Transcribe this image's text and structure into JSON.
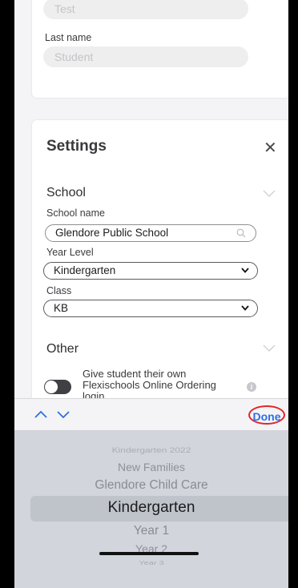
{
  "student": {
    "first_name_value": "Test",
    "last_name_label": "Last name",
    "last_name_placeholder": "Student"
  },
  "settings": {
    "title": "Settings",
    "close_glyph": "✕",
    "school_section": {
      "heading": "School",
      "school_name_label": "School name",
      "school_name_value": "Glendore Public School",
      "year_level_label": "Year Level",
      "year_level_value": "Kindergarten",
      "class_label": "Class",
      "class_value": "KB"
    },
    "other_section": {
      "heading": "Other",
      "toggle_text_line1": "Give student their own",
      "toggle_text_line2": "Flexischools Online Ordering",
      "toggle_text_line3": "login",
      "toggle_on": false,
      "info_glyph": "i"
    }
  },
  "toolbar": {
    "done_label": "Done",
    "prev_icon": "chevron-up-icon",
    "next_icon": "chevron-down-icon"
  },
  "picker": {
    "items": [
      "Kindergarten 2022",
      "New Families",
      "Glendore Child Care",
      "Kindergarten",
      "Year 1",
      "Year 2",
      "Year 3"
    ],
    "selected": "Kindergarten"
  },
  "colors": {
    "accent": "#2f6fe4",
    "annotation_circle": "#e0262a",
    "picker_bg": "#d2d5db"
  }
}
